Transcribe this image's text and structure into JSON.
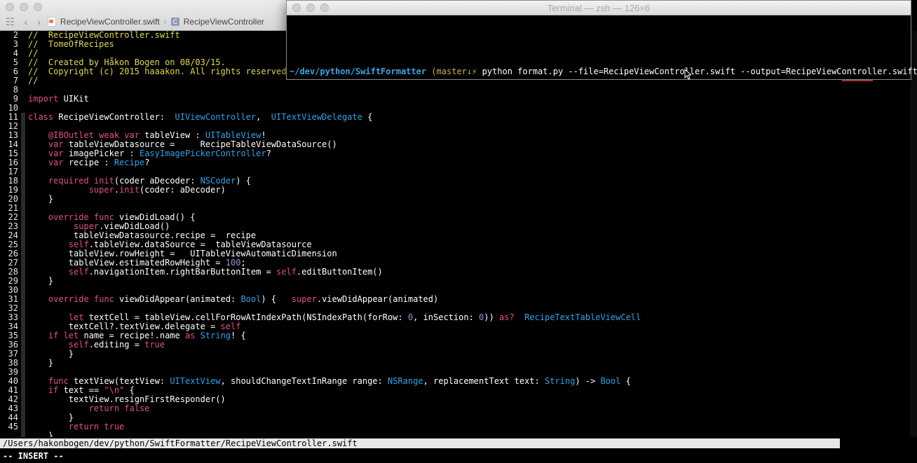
{
  "editor": {
    "breadcrumb": [
      {
        "label": "RecipeViewController.swift",
        "kind": "file"
      },
      {
        "label": "RecipeViewController",
        "kind": "class"
      }
    ],
    "lines": [
      {
        "n": "2",
        "gutter": false,
        "segs": [
          {
            "t": "//  RecipeViewController.swift",
            "c": "c"
          }
        ]
      },
      {
        "n": "3",
        "gutter": false,
        "segs": [
          {
            "t": "//  TomeOfRecipes",
            "c": "c"
          }
        ]
      },
      {
        "n": "4",
        "gutter": false,
        "segs": [
          {
            "t": "//",
            "c": "c"
          }
        ]
      },
      {
        "n": "5",
        "gutter": false,
        "segs": [
          {
            "t": "//  Created by Håkon Bogen on 08/03/15.",
            "c": "c"
          }
        ]
      },
      {
        "n": "6",
        "gutter": false,
        "segs": [
          {
            "t": "//  Copyright (c) 2015 haaakon. All rights reserved.",
            "c": "c"
          }
        ]
      },
      {
        "n": "7",
        "gutter": false,
        "segs": [
          {
            "t": "//",
            "c": "c"
          }
        ]
      },
      {
        "n": "8",
        "gutter": false,
        "segs": []
      },
      {
        "n": "9",
        "gutter": false,
        "segs": [
          {
            "t": "import",
            "c": "k"
          },
          {
            "t": " UIKit",
            "c": ""
          }
        ]
      },
      {
        "n": "10",
        "gutter": false,
        "segs": []
      },
      {
        "n": "11",
        "gutter": true,
        "segs": [
          {
            "t": "class",
            "c": "k"
          },
          {
            "t": " RecipeViewController:  ",
            "c": ""
          },
          {
            "t": "UIViewController",
            "c": "t"
          },
          {
            "t": ",  ",
            "c": ""
          },
          {
            "t": "UITextViewDelegate",
            "c": "t"
          },
          {
            "t": " {",
            "c": ""
          }
        ]
      },
      {
        "n": "12",
        "gutter": true,
        "segs": []
      },
      {
        "n": "13",
        "gutter": true,
        "segs": [
          {
            "t": "    ",
            "c": ""
          },
          {
            "t": "@IBOutlet weak var",
            "c": "k"
          },
          {
            "t": " tableView : ",
            "c": ""
          },
          {
            "t": "UITableView",
            "c": "t"
          },
          {
            "t": "!",
            "c": ""
          }
        ]
      },
      {
        "n": "14",
        "gutter": true,
        "segs": [
          {
            "t": "    ",
            "c": ""
          },
          {
            "t": "var",
            "c": "k"
          },
          {
            "t": " tableViewDatasource =     RecipeTableViewDataSource()",
            "c": ""
          }
        ]
      },
      {
        "n": "15",
        "gutter": true,
        "segs": [
          {
            "t": "    ",
            "c": ""
          },
          {
            "t": "var",
            "c": "k"
          },
          {
            "t": " imagePicker : ",
            "c": ""
          },
          {
            "t": "EasyImagePickerController",
            "c": "t"
          },
          {
            "t": "?",
            "c": ""
          }
        ]
      },
      {
        "n": "16",
        "gutter": true,
        "segs": [
          {
            "t": "    ",
            "c": ""
          },
          {
            "t": "var",
            "c": "k"
          },
          {
            "t": " recipe : ",
            "c": ""
          },
          {
            "t": "Recipe",
            "c": "t"
          },
          {
            "t": "?",
            "c": ""
          }
        ]
      },
      {
        "n": "17",
        "gutter": true,
        "segs": []
      },
      {
        "n": "18",
        "gutter": true,
        "segs": [
          {
            "t": "    ",
            "c": ""
          },
          {
            "t": "required",
            "c": "k"
          },
          {
            "t": " ",
            "c": ""
          },
          {
            "t": "init",
            "c": "k"
          },
          {
            "t": "(coder aDecoder: ",
            "c": ""
          },
          {
            "t": "NSCoder",
            "c": "t"
          },
          {
            "t": ") {",
            "c": ""
          }
        ]
      },
      {
        "n": "19",
        "gutter": true,
        "segs": [
          {
            "t": "            ",
            "c": ""
          },
          {
            "t": "super",
            "c": "k"
          },
          {
            "t": ".",
            "c": ""
          },
          {
            "t": "init",
            "c": "k"
          },
          {
            "t": "(coder: aDecoder)",
            "c": ""
          }
        ]
      },
      {
        "n": "20",
        "gutter": true,
        "segs": [
          {
            "t": "    }",
            "c": ""
          }
        ]
      },
      {
        "n": "21",
        "gutter": true,
        "segs": []
      },
      {
        "n": "22",
        "gutter": true,
        "segs": [
          {
            "t": "    ",
            "c": ""
          },
          {
            "t": "override func",
            "c": "k"
          },
          {
            "t": " viewDidLoad() {",
            "c": ""
          }
        ]
      },
      {
        "n": "23",
        "gutter": true,
        "segs": [
          {
            "t": "         ",
            "c": ""
          },
          {
            "t": "super",
            "c": "k"
          },
          {
            "t": ".viewDidLoad()",
            "c": ""
          }
        ]
      },
      {
        "n": "24",
        "gutter": true,
        "segs": [
          {
            "t": "         tableViewDatasource.recipe =  recipe",
            "c": ""
          }
        ]
      },
      {
        "n": "25",
        "gutter": true,
        "segs": [
          {
            "t": "        ",
            "c": ""
          },
          {
            "t": "self",
            "c": "k"
          },
          {
            "t": ".tableView.dataSource =  tableViewDatasource",
            "c": ""
          }
        ]
      },
      {
        "n": "26",
        "gutter": true,
        "segs": [
          {
            "t": "        tableView.rowHeight =   UITableViewAutomaticDimension",
            "c": ""
          }
        ]
      },
      {
        "n": "27",
        "gutter": true,
        "segs": [
          {
            "t": "        tableView.estimatedRowHeight = ",
            "c": ""
          },
          {
            "t": "100",
            "c": "n"
          },
          {
            "t": ";",
            "c": ""
          }
        ]
      },
      {
        "n": "28",
        "gutter": true,
        "segs": [
          {
            "t": "        ",
            "c": ""
          },
          {
            "t": "self",
            "c": "k"
          },
          {
            "t": ".navigationItem.rightBarButtonItem = ",
            "c": ""
          },
          {
            "t": "self",
            "c": "k"
          },
          {
            "t": ".editButtonItem()",
            "c": ""
          }
        ]
      },
      {
        "n": "29",
        "gutter": true,
        "segs": [
          {
            "t": "    }",
            "c": ""
          }
        ]
      },
      {
        "n": "30",
        "gutter": true,
        "segs": []
      },
      {
        "n": "31",
        "gutter": true,
        "segs": [
          {
            "t": "    ",
            "c": ""
          },
          {
            "t": "override func",
            "c": "k"
          },
          {
            "t": " viewDidAppear(animated: ",
            "c": ""
          },
          {
            "t": "Bool",
            "c": "t"
          },
          {
            "t": ") {   ",
            "c": ""
          },
          {
            "t": "super",
            "c": "k"
          },
          {
            "t": ".viewDidAppear(animated)",
            "c": ""
          }
        ]
      },
      {
        "n": "32",
        "gutter": true,
        "segs": []
      },
      {
        "n": "33",
        "gutter": true,
        "segs": [
          {
            "t": "        ",
            "c": ""
          },
          {
            "t": "let",
            "c": "k"
          },
          {
            "t": " textCell = tableView.cellForRowAtIndexPath(NSIndexPath(forRow: ",
            "c": ""
          },
          {
            "t": "0",
            "c": "n"
          },
          {
            "t": ", inSection: ",
            "c": ""
          },
          {
            "t": "0",
            "c": "n"
          },
          {
            "t": ")) ",
            "c": ""
          },
          {
            "t": "as?",
            "c": "k"
          },
          {
            "t": "  ",
            "c": ""
          },
          {
            "t": "RecipeTextTableViewCell",
            "c": "t"
          }
        ]
      },
      {
        "n": "34",
        "gutter": true,
        "segs": [
          {
            "t": "        textCell?.textView.delegate = ",
            "c": ""
          },
          {
            "t": "self",
            "c": "k"
          }
        ]
      },
      {
        "n": "35",
        "gutter": true,
        "segs": [
          {
            "t": "    ",
            "c": ""
          },
          {
            "t": "if let",
            "c": "k"
          },
          {
            "t": " name = recipe!.name ",
            "c": ""
          },
          {
            "t": "as",
            "c": "k"
          },
          {
            "t": " ",
            "c": ""
          },
          {
            "t": "String",
            "c": "t"
          },
          {
            "t": "! {",
            "c": ""
          }
        ]
      },
      {
        "n": "36",
        "gutter": true,
        "segs": [
          {
            "t": "        ",
            "c": ""
          },
          {
            "t": "self",
            "c": "k"
          },
          {
            "t": ".editing = ",
            "c": ""
          },
          {
            "t": "true",
            "c": "k"
          }
        ]
      },
      {
        "n": "37",
        "gutter": true,
        "segs": [
          {
            "t": "        }",
            "c": ""
          }
        ]
      },
      {
        "n": "38",
        "gutter": true,
        "segs": [
          {
            "t": "    }",
            "c": ""
          }
        ]
      },
      {
        "n": "39",
        "gutter": true,
        "segs": []
      },
      {
        "n": "40",
        "gutter": true,
        "segs": [
          {
            "t": "    ",
            "c": ""
          },
          {
            "t": "func",
            "c": "k"
          },
          {
            "t": " textView(textView: ",
            "c": ""
          },
          {
            "t": "UITextView",
            "c": "t"
          },
          {
            "t": ", shouldChangeTextInRange range: ",
            "c": ""
          },
          {
            "t": "NSRange",
            "c": "t"
          },
          {
            "t": ", replacementText text: ",
            "c": ""
          },
          {
            "t": "String",
            "c": "t"
          },
          {
            "t": ") -> ",
            "c": ""
          },
          {
            "t": "Bool",
            "c": "t"
          },
          {
            "t": " {",
            "c": ""
          }
        ]
      },
      {
        "n": "41",
        "gutter": true,
        "segs": [
          {
            "t": "    ",
            "c": ""
          },
          {
            "t": "if",
            "c": "k"
          },
          {
            "t": " text == ",
            "c": ""
          },
          {
            "t": "\"\\n\"",
            "c": "s"
          },
          {
            "t": " {",
            "c": ""
          }
        ]
      },
      {
        "n": "42",
        "gutter": true,
        "segs": [
          {
            "t": "        textView.resignFirstResponder()",
            "c": ""
          }
        ]
      },
      {
        "n": "43",
        "gutter": true,
        "segs": [
          {
            "t": "            ",
            "c": ""
          },
          {
            "t": "return false",
            "c": "k"
          }
        ]
      },
      {
        "n": "44",
        "gutter": true,
        "segs": [
          {
            "t": "        }",
            "c": ""
          }
        ]
      },
      {
        "n": "45",
        "gutter": true,
        "segs": [
          {
            "t": "        ",
            "c": ""
          },
          {
            "t": "return true",
            "c": "k"
          }
        ]
      },
      {
        "n": "",
        "gutter": true,
        "segs": [
          {
            "t": "    }",
            "c": ""
          }
        ]
      }
    ],
    "status_path": "/Users/hakonbogen/dev/python/SwiftFormatter/RecipeViewController.swift",
    "mode": "-- INSERT --"
  },
  "terminal": {
    "title": "Terminal — zsh — 126×6",
    "prompt_path": "~/dev/python/SwiftFormatter",
    "prompt_branch": " (master↓",
    "prompt_bolt": "⚡",
    "command": " python format.py --file=RecipeViewController.swift --output=RecipeViewController.swift"
  },
  "colors": {
    "comment": "#e0d94b",
    "keyword": "#e24f88",
    "type": "#2da3e8",
    "number": "#a58ad8",
    "prompt_path": "#3aa3e3"
  }
}
